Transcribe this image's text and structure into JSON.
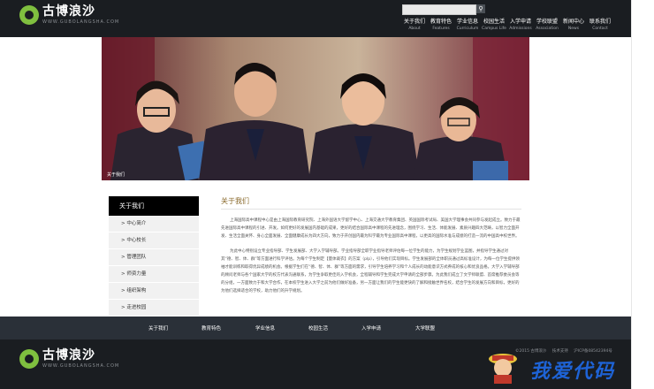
{
  "brand": {
    "name_cn": "古博浪沙",
    "name_en": "WWW.GUBOLANGSHA.COM",
    "accent": "#7fbf3f"
  },
  "header": {
    "search_placeholder": ""
  },
  "nav": [
    {
      "cn": "关于我们",
      "en": "About"
    },
    {
      "cn": "教育特色",
      "en": "Features"
    },
    {
      "cn": "学业信息",
      "en": "Curriculum"
    },
    {
      "cn": "校园生活",
      "en": "Campus Life"
    },
    {
      "cn": "入学申请",
      "en": "Admissions"
    },
    {
      "cn": "学校联盟",
      "en": "Association"
    },
    {
      "cn": "新闻中心",
      "en": "News"
    },
    {
      "cn": "联系我们",
      "en": "Contact"
    }
  ],
  "hero": {
    "caption": "关于我们"
  },
  "sidebar": {
    "heading": "关于我们",
    "items": [
      "> 中心简介",
      "> 中心校长",
      "> 管理团队",
      "> 师资力量",
      "> 组织架构",
      "> 走进校园"
    ]
  },
  "content": {
    "title": "关于我们",
    "paragraphs": [
      "上海国际高中课程中心是由上海国际教育研究院、上海外国语大学留学中心、上海交通大学教育集团、英国国际考试局、美国大学理事会共同参与发起成立。致力于最先进国际高中课程的引进、开发。如何更好的发展国内基础的成果，更好的结合国际高中课程的先进理念，围绕学习、生活、体能发展、素质兴趣四大范畴，以智力全面开发、生活全面关怀、身心全面发展、全面健康成长为四大方向，致力于开创国内最为科学最为专业国际高中课程，以更高的国际水准与成绩的打造一流的中国高中校世界。",
      "为此中心特别设立专业指导部、学生发展部、大学入学辅导部。学业指导部全职学业指导老师评估每一位学生的能力，为学生规划学业蓝图，并指导学生通过对其“德、智、体、群”等方面进行科学评估。为每个学生制定【量体裁衣】的方案（plp），引导他们实现目标。学生发展部的全体职员通过高标准设计，为每一位学生提供领袖才能训练和取得优异成绩的机会。根据学生们在“德、智、体、群”等方面的需求，引导学生培养学习和个人成长的动能意识方式养成的核心和优良品格。大学入学辅导部的顾问老师与各个国家大学的校方代表沟通联系，为学生争取更佳的入学机会，全程辅导和学生完成大学申请的全部步骤。为此我们成立了文学师联盟、首席推荐委员会等的分组，一方面致力于和大学合作，在本校学生进入大学之前为他们做好准备，另一方面让我们的学生能更快的了解和接触世界名校，结合学生的发展方向和目标，更好的为他们选择适合的学校，助力他们的升学规划。"
    ]
  },
  "footer_nav": [
    "关于我们",
    "教育特色",
    "学业信息",
    "校园生活",
    "入学申请",
    "大学联盟"
  ],
  "footer": {
    "info": [
      "©2015 古博浪沙",
      "技术支持",
      "沪ICP备08542394号"
    ]
  },
  "watermark": {
    "text": "我爱代码",
    "color": "#1e63d6"
  }
}
